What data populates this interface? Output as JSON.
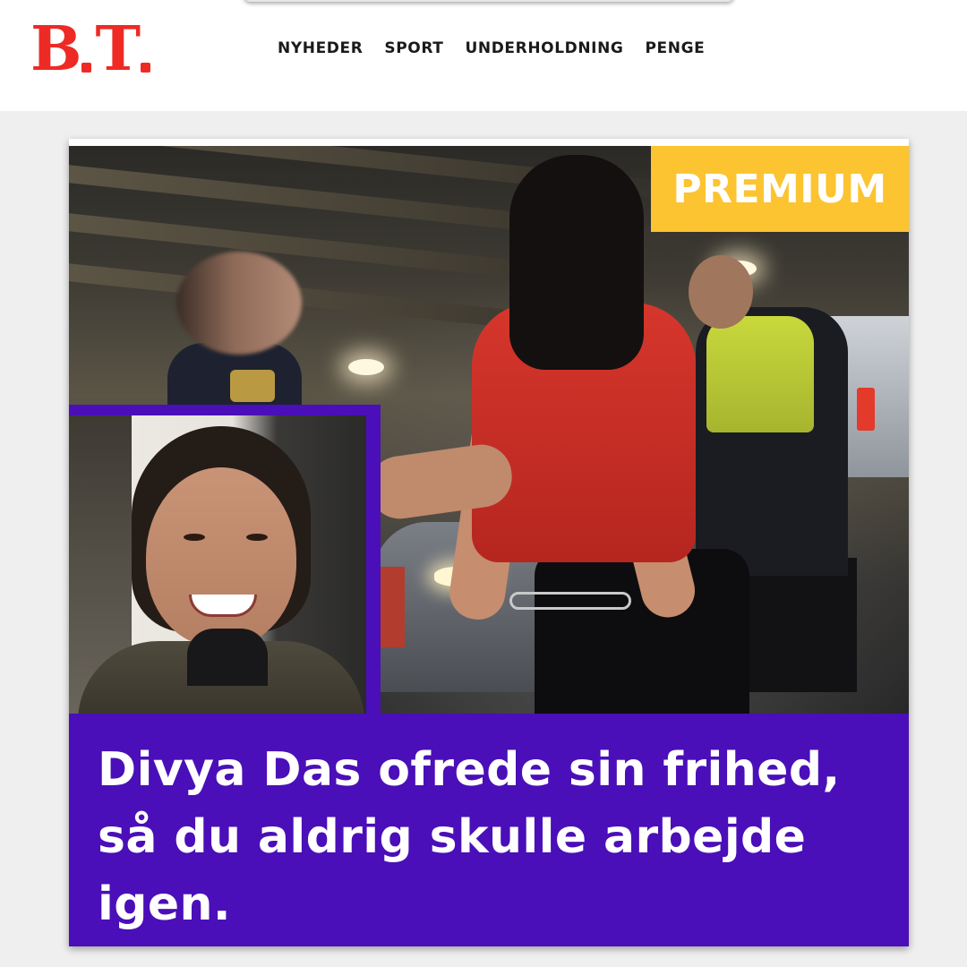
{
  "site": {
    "logo_text": "B.T.",
    "brand_color": "#ee2a24"
  },
  "nav": {
    "items": [
      {
        "label": "NYHEDER"
      },
      {
        "label": "SPORT"
      },
      {
        "label": "UNDERHOLDNING"
      },
      {
        "label": "PENGE"
      }
    ]
  },
  "article": {
    "badge": "PREMIUM",
    "badge_color": "#fbc430",
    "accent_color": "#4a0fb8",
    "headline": "Divya Das ofrede sin frihed, så du aldrig skulle arbejde igen."
  }
}
